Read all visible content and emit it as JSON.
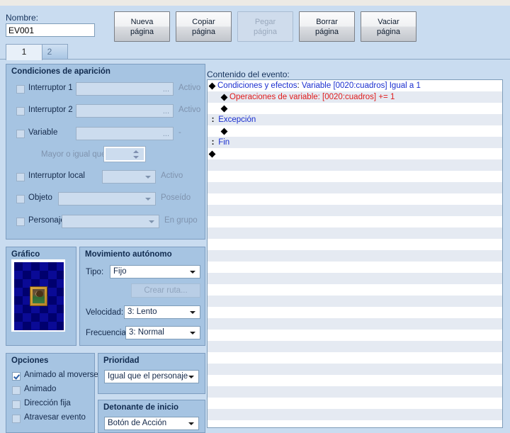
{
  "window": {
    "name_label": "Nombre:",
    "name_value": "EV001"
  },
  "toolbar": {
    "buttons": [
      {
        "line1": "Nueva",
        "line2": "página",
        "name": "new-page-button",
        "disabled": false
      },
      {
        "line1": "Copiar",
        "line2": "página",
        "name": "copy-page-button",
        "disabled": false
      },
      {
        "line1": "Pegar",
        "line2": "página",
        "name": "paste-page-button",
        "disabled": true
      },
      {
        "line1": "Borrar",
        "line2": "página",
        "name": "delete-page-button",
        "disabled": false
      },
      {
        "line1": "Vaciar",
        "line2": "página",
        "name": "clear-page-button",
        "disabled": false
      }
    ]
  },
  "tabs": [
    {
      "label": "1",
      "active": true
    },
    {
      "label": "2",
      "active": false
    }
  ],
  "conditions": {
    "title": "Condiciones de aparición",
    "switch1": {
      "label": "Interruptor 1",
      "value": "",
      "suffix": "Activo",
      "checked": false,
      "browse": "..."
    },
    "switch2": {
      "label": "Interruptor 2",
      "value": "",
      "suffix": "Activo",
      "checked": false,
      "browse": "..."
    },
    "variable": {
      "label": "Variable",
      "value": "",
      "suffix": "-",
      "checked": false,
      "browse": "..."
    },
    "greater_label": "Mayor o igual que",
    "greater_value": "",
    "local_switch": {
      "label": "Interruptor local",
      "value": "",
      "suffix": "Activo",
      "checked": false
    },
    "item": {
      "label": "Objeto",
      "value": "",
      "suffix": "Poseído",
      "checked": false
    },
    "actor": {
      "label": "Personaje",
      "value": "",
      "suffix": "En grupo",
      "checked": false
    }
  },
  "graphic": {
    "title": "Gráfico"
  },
  "movement": {
    "title": "Movimiento autónomo",
    "type_label": "Tipo:",
    "type_value": "Fijo",
    "route_button": "Crear ruta...",
    "speed_label": "Velocidad:",
    "speed_value": "3: Lento",
    "freq_label": "Frecuencia:",
    "freq_value": "3: Normal"
  },
  "options": {
    "title": "Opciones",
    "items": [
      {
        "label": "Animado al moverse",
        "checked": true
      },
      {
        "label": "Animado",
        "checked": false
      },
      {
        "label": "Dirección fija",
        "checked": false
      },
      {
        "label": "Atravesar evento",
        "checked": false
      }
    ]
  },
  "priority": {
    "title": "Prioridad",
    "value": "Igual que el personaje"
  },
  "trigger": {
    "title": "Detonante de inicio",
    "value": "Botón de Acción"
  },
  "event_content": {
    "label": "Contenido del evento:",
    "rows": [
      {
        "indent": 0,
        "bullet": "diamond",
        "segments": [
          {
            "text": "Condiciones y efectos",
            "color": "blue"
          },
          {
            "text": ":",
            "color": "black"
          },
          {
            "text": " Variable [0020:cuadros] Igual a 1",
            "color": "blue"
          }
        ]
      },
      {
        "indent": 1,
        "bullet": "diamond",
        "segments": [
          {
            "text": "Operaciones de variable: [0020:cuadros] += 1",
            "color": "red"
          }
        ]
      },
      {
        "indent": 1,
        "bullet": "diamond",
        "segments": []
      },
      {
        "indent": 0,
        "bullet": "colon",
        "segments": [
          {
            "text": "Excepción",
            "color": "blue"
          }
        ]
      },
      {
        "indent": 1,
        "bullet": "diamond",
        "segments": []
      },
      {
        "indent": 0,
        "bullet": "colon",
        "segments": [
          {
            "text": "Fin",
            "color": "blue"
          }
        ]
      },
      {
        "indent": 0,
        "bullet": "diamond",
        "segments": []
      }
    ],
    "empty_rows": 24
  }
}
